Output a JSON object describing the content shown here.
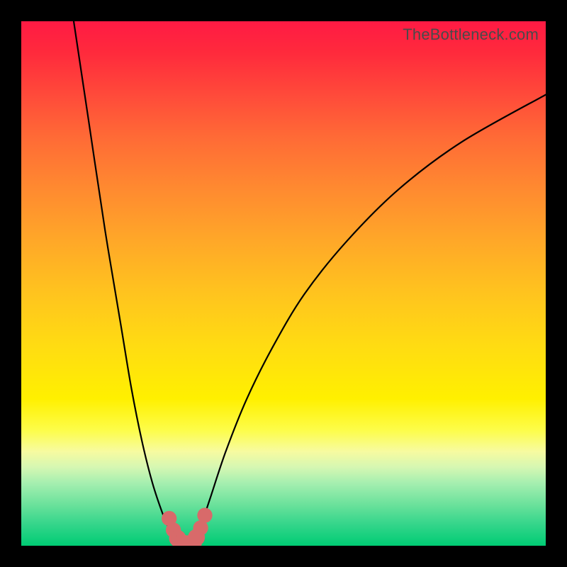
{
  "watermark": "TheBottleneck.com",
  "colors": {
    "frame": "#000000",
    "curve": "#000000",
    "marker": "#d86a6a",
    "gradient_top": "#ff1a44",
    "gradient_bottom": "#00cc74"
  },
  "chart_data": {
    "type": "line",
    "title": "",
    "xlabel": "",
    "ylabel": "",
    "xlim": [
      0,
      100
    ],
    "ylim": [
      0,
      100
    ],
    "grid": false,
    "legend": false,
    "series": [
      {
        "name": "left-curve",
        "x": [
          10,
          13,
          16,
          19,
          21,
          23,
          25,
          27,
          28.5,
          29.5,
          30
        ],
        "y": [
          100,
          80,
          60,
          42,
          30,
          20,
          12,
          6,
          2.5,
          0.8,
          0
        ]
      },
      {
        "name": "right-curve",
        "x": [
          33,
          34,
          36,
          39,
          43,
          48,
          54,
          62,
          72,
          84,
          100
        ],
        "y": [
          0,
          3,
          9,
          18,
          28,
          38,
          48,
          58,
          68,
          77,
          86
        ]
      },
      {
        "name": "trough-flat",
        "x": [
          30,
          31,
          32,
          33
        ],
        "y": [
          0,
          0,
          0,
          0
        ]
      }
    ],
    "markers": [
      {
        "x": 28.2,
        "y": 5.2,
        "r": 1.0
      },
      {
        "x": 29.0,
        "y": 3.0,
        "r": 1.0
      },
      {
        "x": 29.8,
        "y": 1.4,
        "r": 1.2
      },
      {
        "x": 30.6,
        "y": 0.4,
        "r": 1.4
      },
      {
        "x": 31.6,
        "y": 0.0,
        "r": 1.6
      },
      {
        "x": 32.6,
        "y": 0.4,
        "r": 1.4
      },
      {
        "x": 33.4,
        "y": 1.6,
        "r": 1.2
      },
      {
        "x": 34.2,
        "y": 3.4,
        "r": 1.0
      },
      {
        "x": 35.0,
        "y": 5.8,
        "r": 1.0
      }
    ]
  }
}
